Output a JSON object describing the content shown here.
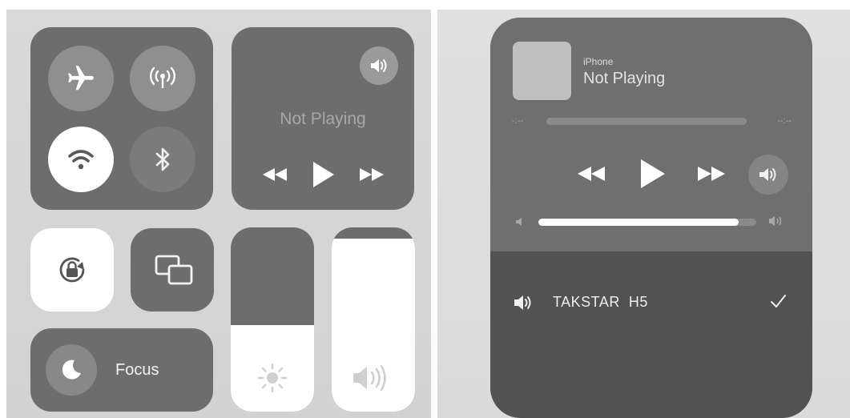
{
  "control_center": {
    "connectivity": {
      "airplane_mode": {
        "icon": "airplane-icon",
        "enabled": false
      },
      "cellular_data": {
        "icon": "cellular-antenna-icon",
        "enabled": false
      },
      "wifi": {
        "icon": "wifi-icon",
        "enabled": true
      },
      "bluetooth": {
        "icon": "bluetooth-icon",
        "enabled": false
      }
    },
    "media": {
      "status": "Not Playing",
      "airplay_icon": "speaker-airplay-icon",
      "controls": [
        "rewind-icon",
        "play-icon",
        "fast-forward-icon"
      ]
    },
    "orientation_lock": {
      "icon": "orientation-lock-icon",
      "enabled": true
    },
    "screen_mirroring": {
      "icon": "screen-mirroring-icon"
    },
    "focus": {
      "label": "Focus",
      "icon": "moon-icon"
    },
    "brightness": {
      "level": 0.47,
      "icon": "sun-icon"
    },
    "volume": {
      "level": 0.94,
      "icon": "speaker-icon"
    }
  },
  "now_playing": {
    "device": "iPhone",
    "status": "Not Playing",
    "elapsed": "-:--",
    "remaining": "--:--",
    "volume_level": 0.92,
    "output": {
      "device": "TAKSTAR  H5",
      "selected": true
    }
  },
  "colors": {
    "tile": "#6d6d6d",
    "active": "#ffffff",
    "output_section": "#525252"
  }
}
